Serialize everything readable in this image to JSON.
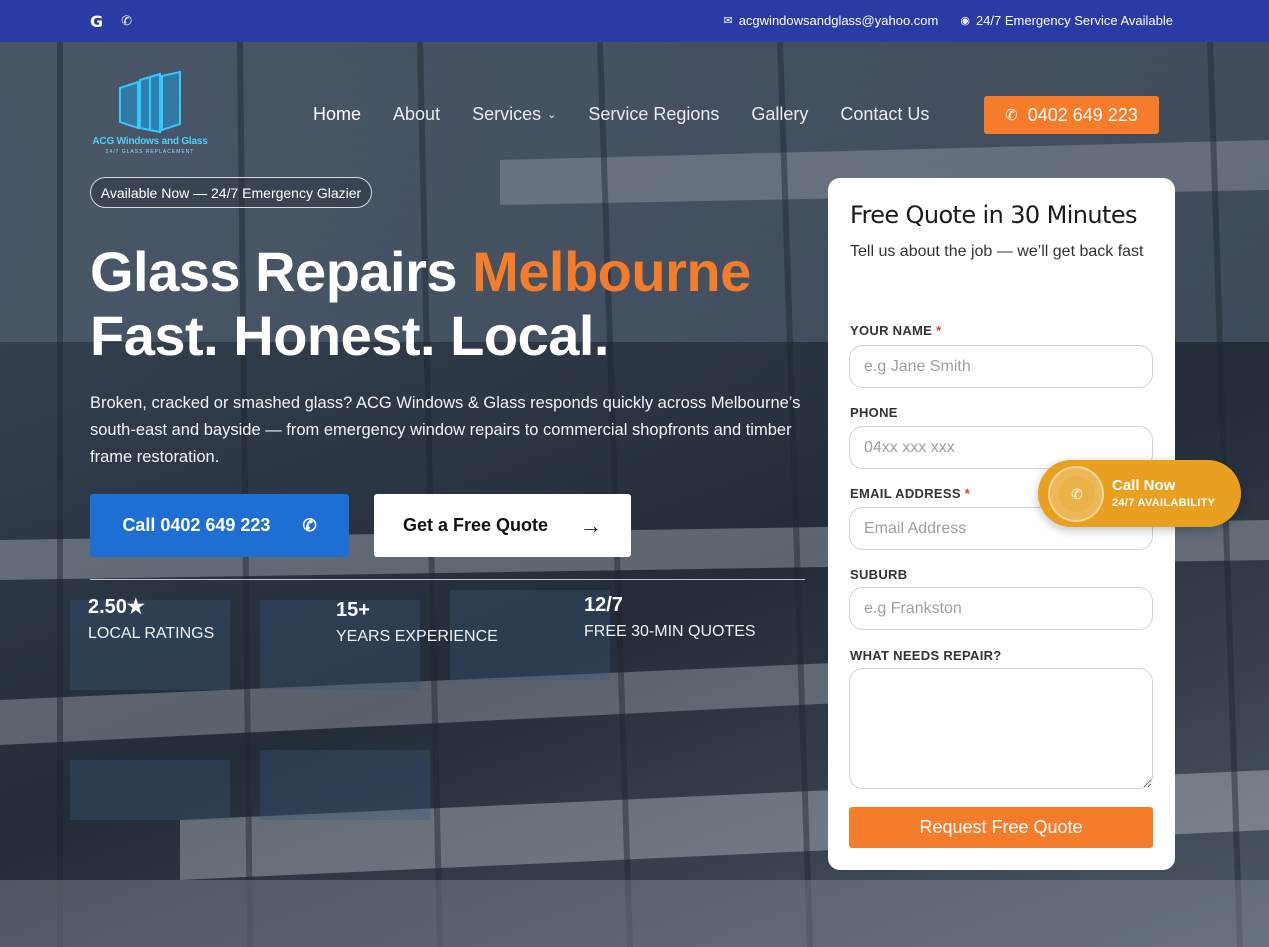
{
  "colors": {
    "topbar": "#2a3ba5",
    "accent": "#f47c2a",
    "primary": "#1e6fd4",
    "float": "#e9a020"
  },
  "topbar": {
    "social_icons": [
      "google-icon",
      "phone-icon"
    ],
    "email": "acgwindowsandglass@yahoo.com",
    "service": "24/7 Emergency Service Available"
  },
  "logo": {
    "brand": "ACG Windows and Glass",
    "tagline": "24/7 GLASS REPLACEMENT"
  },
  "nav": {
    "items": [
      "Home",
      "About",
      "Services",
      "Service Regions",
      "Gallery",
      "Contact Us"
    ],
    "call_label": "0402 649 223"
  },
  "hero": {
    "pill": "Available Now — 24/7 Emergency Glazier",
    "headline_1": "Glass Repairs ",
    "headline_accent": "Melbourne",
    "headline_2": "Fast. Honest. Local.",
    "lead": "Broken, cracked or smashed glass? ACG Windows & Glass responds quickly across Melbourne’s south-east and bayside — from emergency window repairs to commercial shopfronts and timber frame restoration.",
    "call_btn": "Call 0402 649 223",
    "quote_btn": "Get a Free Quote",
    "stats": [
      {
        "value": "2.50★",
        "label": "LOCAL RATINGS"
      },
      {
        "value": "15+",
        "label": "YEARS EXPERIENCE"
      },
      {
        "value": "12/7",
        "label": "FREE 30-MIN QUOTES"
      }
    ]
  },
  "form": {
    "title": "Free Quote in 30 Minutes",
    "subtitle": "Tell us about the job — we’ll get back fast",
    "name_label": "YOUR NAME",
    "name_placeholder": "e.g Jane Smith",
    "phone_label": "PHONE",
    "phone_placeholder": "04xx xxx xxx",
    "email_label": "EMAIL ADDRESS",
    "email_placeholder": "Email Address",
    "suburb_label": "SUBURB",
    "suburb_placeholder": "e.g Frankston",
    "repair_label": "WHAT NEEDS REPAIR?",
    "required_mark": "*",
    "submit": "Request Free Quote"
  },
  "float_call": {
    "title": "Call Now",
    "subtitle": "24/7 AVAILABILITY"
  }
}
